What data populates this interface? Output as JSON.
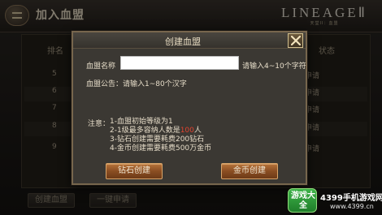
{
  "screen": {
    "title": "加入血盟",
    "logo_name": "LINEAGEⅡ",
    "logo_sub": "天堂II：血盟",
    "columns": {
      "rank": "排名",
      "status": "状态"
    },
    "rows": [
      {
        "rank": "5",
        "status": "未申请"
      },
      {
        "rank": "6",
        "status": "未申请"
      },
      {
        "rank": "7",
        "status": "未申请"
      },
      {
        "rank": "8",
        "status": "未申请"
      },
      {
        "rank": "9",
        "status": "未申请"
      }
    ],
    "bottom_buttons": {
      "create": "创建血盟",
      "apply_all": "一键申请"
    }
  },
  "dialog": {
    "title": "创建血盟",
    "name_label": "血盟名称",
    "name_value": "",
    "name_placeholder": "",
    "name_hint": "请输入4~10个字符",
    "notice_line": "血盟公告：请输入1~80个汉字",
    "rules_label": "注意：",
    "rules": [
      {
        "before": "1-血盟初始等级为1",
        "highlight": "",
        "after": ""
      },
      {
        "before": "2-1级最多容纳人数是",
        "highlight": "100",
        "after": "人"
      },
      {
        "before": "3-钻石创建需要耗费200钻石",
        "highlight": "",
        "after": ""
      },
      {
        "before": "4-金币创建需要耗费500万金币",
        "highlight": "",
        "after": ""
      }
    ],
    "diamond_button": "钻石创建",
    "gold_button": "金币创建"
  },
  "watermark": {
    "badge": "游戏大全",
    "text": "4399手机游戏网",
    "url": "www.4399.cn"
  },
  "colors": {
    "highlight": "#e0432f",
    "button": "#8a4e22",
    "dialog_bg": "#3b3833"
  }
}
